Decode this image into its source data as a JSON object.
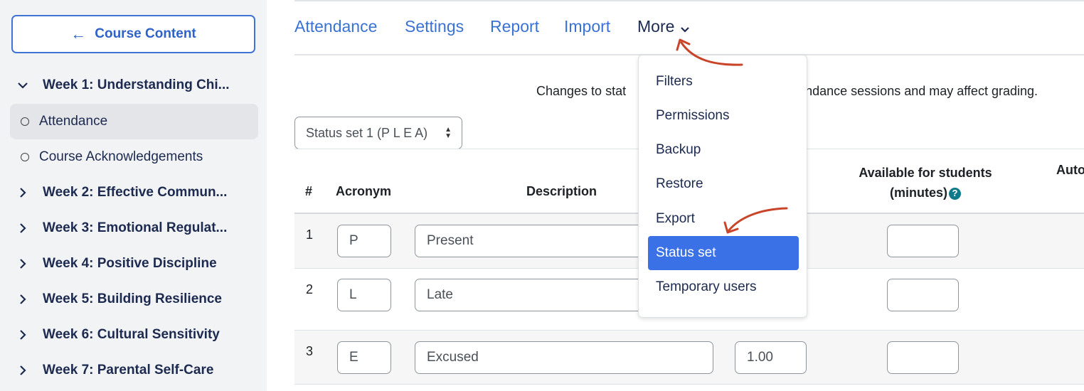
{
  "sidebar": {
    "course_button": {
      "label": "Course Content",
      "icon": "arrow-left-icon"
    },
    "items": [
      {
        "type": "week",
        "label": "Week 1: Understanding Chi...",
        "expanded": true
      },
      {
        "type": "activity",
        "label": "Attendance",
        "active": true
      },
      {
        "type": "activity",
        "label": "Course Acknowledgements"
      },
      {
        "type": "week",
        "label": "Week 2: Effective Commun..."
      },
      {
        "type": "week",
        "label": "Week 3: Emotional Regulat..."
      },
      {
        "type": "week",
        "label": "Week 4: Positive Discipline"
      },
      {
        "type": "week",
        "label": "Week 5: Building Resilience"
      },
      {
        "type": "week",
        "label": "Week 6: Cultural Sensitivity"
      },
      {
        "type": "week",
        "label": "Week 7: Parental Self-Care"
      }
    ]
  },
  "tabs": [
    {
      "label": "Attendance"
    },
    {
      "label": "Settings"
    },
    {
      "label": "Report"
    },
    {
      "label": "Import"
    },
    {
      "label": "More"
    }
  ],
  "notice": "Changes to stat…attendance sessions and may affect grading.",
  "notice_left": "Changes to stat",
  "notice_right": "attendance sessions and may affect grading.",
  "status_set_select": {
    "value": "Status set 1 (P L E A)"
  },
  "table": {
    "headers": {
      "num": "#",
      "acronym": "Acronym",
      "description": "Description",
      "available_line1": "Available for students",
      "available_line2": "(minutes)",
      "auto": "Auto"
    },
    "rows": [
      {
        "num": "1",
        "acronym": "P",
        "description": "Present",
        "grade": "",
        "available": ""
      },
      {
        "num": "2",
        "acronym": "L",
        "description": "Late",
        "grade": "",
        "available": ""
      },
      {
        "num": "3",
        "acronym": "E",
        "description": "Excused",
        "grade": "1.00",
        "available": ""
      }
    ]
  },
  "more_menu": {
    "items": [
      "Filters",
      "Permissions",
      "Backup",
      "Restore",
      "Export",
      "Status set",
      "Temporary users"
    ],
    "selected": "Status set"
  },
  "colors": {
    "link_blue": "#3a72d4",
    "selected_blue": "#3b71e6",
    "annotation_arrow": "#c8452a",
    "help_teal": "#0f7a8c"
  }
}
